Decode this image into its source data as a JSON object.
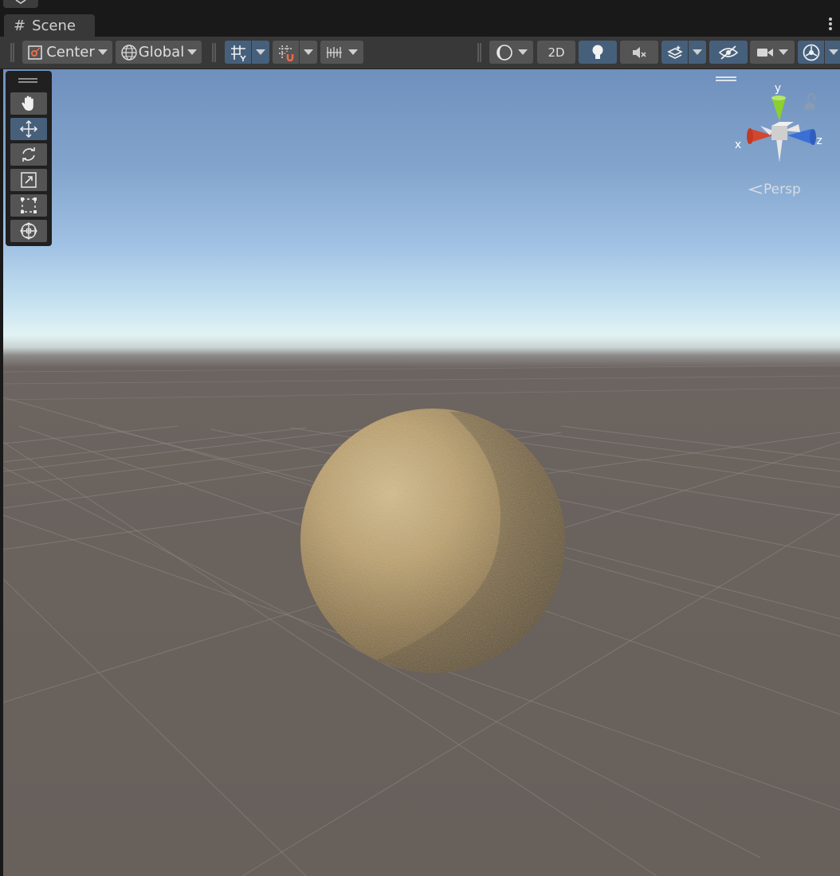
{
  "window": {
    "tab_title": "Scene"
  },
  "toolbar": {
    "pivot_mode": "Center",
    "pivot_rotation": "Global",
    "view_2d": "2D",
    "icons": [
      "pivot-icon",
      "globe-icon",
      "grid-icon",
      "snap-icon",
      "increment-icon",
      "draw-mode-icon",
      "lighting-icon",
      "audio-mute-icon",
      "effects-icon",
      "hidden-objects-icon",
      "camera-icon",
      "gizmos-icon"
    ]
  },
  "tools": {
    "items": [
      "hand-tool",
      "move-tool",
      "rotate-tool",
      "scale-tool",
      "rect-tool",
      "transform-tool"
    ],
    "active": "move-tool"
  },
  "gizmo": {
    "x_label": "x",
    "y_label": "y",
    "z_label": "z",
    "projection": "Persp",
    "colors": {
      "x": "#d3462f",
      "y": "#8ccf2e",
      "z": "#3a6fd6"
    }
  },
  "scene": {
    "object": "sphere"
  }
}
